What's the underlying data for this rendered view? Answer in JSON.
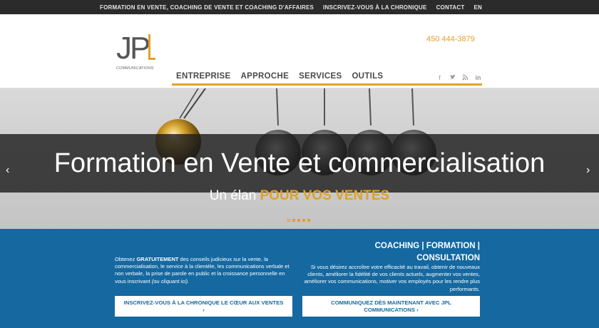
{
  "topnav": {
    "items": [
      "FORMATION EN VENTE, COACHING DE VENTE ET COACHING D'AFFAIRES",
      "INSCRIVEZ-VOUS À LA CHRONIQUE",
      "CONTACT",
      "EN"
    ]
  },
  "header": {
    "logo_text": "JPL",
    "logo_sub": "COMMUNICATIONS",
    "phone": "450 444-3879",
    "mainnav": [
      "ENTREPRISE",
      "APPROCHE",
      "SERVICES",
      "OUTILS"
    ],
    "social_icons": [
      "facebook-icon",
      "twitter-icon",
      "rss-icon",
      "linkedin-icon"
    ]
  },
  "hero": {
    "title": "Formation en Vente et commercialisation",
    "subtitle_plain": "Un élan",
    "subtitle_highlight": "POUR VOS VENTES",
    "slides": 5,
    "active_slide": 1
  },
  "blue": {
    "left_bold": "GRATUITEMENT",
    "left_pre": "Obtenez ",
    "left_post": " des conseils judicieux sur la vente, la commercialisation, le service à la clientèle, les communications verbale et non verbale, la prise de parole en public et la croissance personnelle en vous inscrivant",
    "left_italic": "(ou cliquant ici).",
    "right_head_line1": "COACHING | FORMATION |",
    "right_head_line2": "CONSULTATION",
    "right_text": "Si vous désirez accroître votre efficacité au travail, obtenir de nouveaux clients, améliorer la fidélité de vos clients actuels, augmenter vos ventes, améliorer vos communications, motiver vos employés pour les rendre plus performants.",
    "button1": "INSCRIVEZ-VOUS À LA CHRONIQUE LE CŒUR AUX VENTES ›",
    "button2": "COMMUNIQUEZ DÈS MAINTENANT AVEC JPL COMMUNICATIONS ›"
  },
  "colors": {
    "accent": "#e0a12a",
    "blue": "#1568a0",
    "topbar": "#2b2b2b"
  }
}
